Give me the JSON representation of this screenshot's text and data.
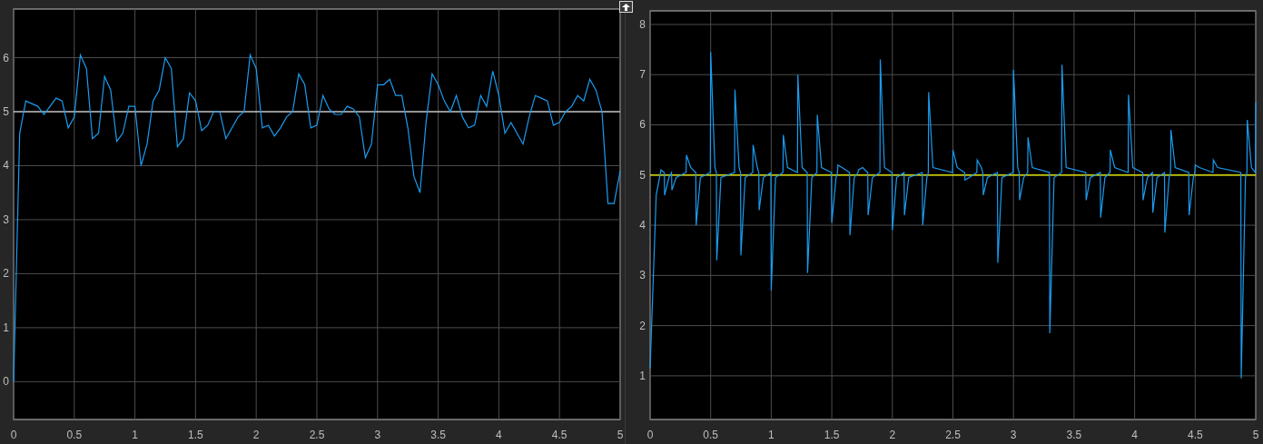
{
  "scopes": [
    {
      "chart_data": {
        "type": "line",
        "grid": true,
        "xlim": [
          0,
          5
        ],
        "ylim": [
          -0.7,
          6.9
        ],
        "xticks": [
          0,
          0.5,
          1,
          1.5,
          2,
          2.5,
          3,
          3.5,
          4,
          4.5,
          5
        ],
        "yticks": [
          0,
          1,
          2,
          3,
          4,
          5,
          6
        ],
        "x": [
          0,
          0.05,
          0.1,
          0.15,
          0.2,
          0.25,
          0.3,
          0.35,
          0.4,
          0.45,
          0.5,
          0.55,
          0.6,
          0.65,
          0.7,
          0.75,
          0.8,
          0.85,
          0.9,
          0.95,
          1,
          1.05,
          1.1,
          1.15,
          1.2,
          1.25,
          1.3,
          1.35,
          1.4,
          1.45,
          1.5,
          1.55,
          1.6,
          1.65,
          1.7,
          1.75,
          1.8,
          1.85,
          1.9,
          1.95,
          2,
          2.05,
          2.1,
          2.15,
          2.2,
          2.25,
          2.3,
          2.35,
          2.4,
          2.45,
          2.5,
          2.55,
          2.6,
          2.65,
          2.7,
          2.75,
          2.8,
          2.85,
          2.9,
          2.95,
          3,
          3.05,
          3.1,
          3.15,
          3.2,
          3.25,
          3.3,
          3.35,
          3.4,
          3.45,
          3.5,
          3.55,
          3.6,
          3.65,
          3.7,
          3.75,
          3.8,
          3.85,
          3.9,
          3.95,
          4,
          4.05,
          4.1,
          4.15,
          4.2,
          4.25,
          4.3,
          4.35,
          4.4,
          4.45,
          4.5,
          4.55,
          4.6,
          4.65,
          4.7,
          4.75,
          4.8,
          4.85,
          4.9,
          4.95,
          5
        ],
        "series": [
          {
            "color": "#1a9cf0",
            "values": [
              0,
              4.6,
              5.2,
              5.15,
              5.1,
              4.95,
              5.1,
              5.25,
              5.2,
              4.7,
              4.9,
              6.05,
              5.8,
              4.5,
              4.6,
              5.65,
              5.4,
              4.45,
              4.6,
              5.1,
              5.1,
              4.0,
              4.4,
              5.2,
              5.4,
              6.0,
              5.8,
              4.35,
              4.5,
              5.35,
              5.2,
              4.65,
              4.75,
              5.0,
              5.0,
              4.5,
              4.7,
              4.9,
              5.0,
              6.05,
              5.8,
              4.7,
              4.75,
              4.55,
              4.7,
              4.9,
              5.0,
              5.7,
              5.5,
              4.7,
              4.75,
              5.3,
              5.05,
              4.95,
              4.95,
              5.1,
              5.05,
              4.9,
              4.15,
              4.4,
              5.5,
              5.5,
              5.6,
              5.3,
              5.3,
              4.7,
              3.8,
              3.5,
              4.8,
              5.7,
              5.5,
              5.2,
              5.0,
              5.3,
              4.9,
              4.7,
              4.75,
              5.3,
              5.1,
              5.75,
              5.3,
              4.6,
              4.8,
              4.6,
              4.4,
              4.9,
              5.3,
              5.25,
              5.2,
              4.75,
              4.8,
              5.0,
              5.1,
              5.3,
              5.2,
              5.6,
              5.4,
              5.0,
              3.3,
              3.3,
              3.9
            ]
          },
          {
            "color": "#ffffff",
            "values": [
              5,
              5,
              5,
              5,
              5,
              5,
              5,
              5,
              5,
              5,
              5,
              5,
              5,
              5,
              5,
              5,
              5,
              5,
              5,
              5,
              5,
              5,
              5,
              5,
              5,
              5,
              5,
              5,
              5,
              5,
              5,
              5,
              5,
              5,
              5,
              5,
              5,
              5,
              5,
              5,
              5,
              5,
              5,
              5,
              5,
              5,
              5,
              5,
              5,
              5,
              5,
              5,
              5,
              5,
              5,
              5,
              5,
              5,
              5,
              5,
              5,
              5,
              5,
              5,
              5,
              5,
              5,
              5,
              5,
              5,
              5,
              5,
              5,
              5,
              5,
              5,
              5,
              5,
              5,
              5,
              5,
              5,
              5,
              5,
              5,
              5,
              5,
              5,
              5,
              5,
              5,
              5,
              5,
              5,
              5,
              5,
              5,
              5,
              5,
              5,
              5
            ]
          }
        ]
      }
    },
    {
      "chart_data": {
        "type": "line",
        "grid": true,
        "xlim": [
          0,
          5
        ],
        "ylim": [
          0.13,
          8.27
        ],
        "xticks": [
          0,
          0.5,
          1,
          1.5,
          2,
          2.5,
          3,
          3.5,
          4,
          4.5,
          5
        ],
        "yticks": [
          1,
          2,
          3,
          4,
          5,
          6,
          7,
          8
        ],
        "x": [
          0,
          0.05,
          0.09,
          0.117,
          0.12,
          0.155,
          0.177,
          0.18,
          0.215,
          0.297,
          0.3,
          0.335,
          0.377,
          0.38,
          0.415,
          0.497,
          0.5,
          0.535,
          0.547,
          0.55,
          0.585,
          0.697,
          0.7,
          0.735,
          0.747,
          0.75,
          0.785,
          0.847,
          0.85,
          0.885,
          0.897,
          0.9,
          0.935,
          0.997,
          1,
          1.035,
          1.097,
          1.1,
          1.135,
          1.217,
          1.22,
          1.255,
          1.297,
          1.3,
          1.335,
          1.377,
          1.38,
          1.415,
          1.497,
          1.5,
          1.535,
          1.547,
          1.55,
          1.585,
          1.647,
          1.65,
          1.685,
          1.717,
          1.72,
          1.755,
          1.797,
          1.8,
          1.835,
          1.897,
          1.9,
          1.935,
          1.997,
          2,
          2.035,
          2.097,
          2.1,
          2.135,
          2.247,
          2.25,
          2.285,
          2.297,
          2.3,
          2.335,
          2.497,
          2.5,
          2.535,
          2.597,
          2.6,
          2.635,
          2.697,
          2.7,
          2.735,
          2.747,
          2.75,
          2.785,
          2.867,
          2.87,
          2.905,
          2.997,
          3,
          3.035,
          3.047,
          3.05,
          3.085,
          3.117,
          3.12,
          3.155,
          3.297,
          3.3,
          3.335,
          3.397,
          3.4,
          3.435,
          3.597,
          3.6,
          3.635,
          3.717,
          3.72,
          3.755,
          3.797,
          3.8,
          3.835,
          3.947,
          3.95,
          3.985,
          4.067,
          4.07,
          4.105,
          4.147,
          4.15,
          4.185,
          4.247,
          4.25,
          4.285,
          4.297,
          4.3,
          4.335,
          4.447,
          4.45,
          4.485,
          4.497,
          4.5,
          4.535,
          4.647,
          4.65,
          4.685,
          4.877,
          4.88,
          4.915,
          4.927,
          4.93,
          4.965,
          4.997,
          5
        ],
        "series": [
          {
            "color": "#1a9cf0",
            "values": [
              1.15,
              4.6,
              5.1,
              5.05,
              4.6,
              4.95,
              5.05,
              4.7,
              4.95,
              5.05,
              5.4,
              5.15,
              5.05,
              4.0,
              4.95,
              5.05,
              7.45,
              5.15,
              5.05,
              3.3,
              4.95,
              5.05,
              6.7,
              5.15,
              5.05,
              3.4,
              4.95,
              5.05,
              5.6,
              5.15,
              5.05,
              4.3,
              4.95,
              5.05,
              2.7,
              4.95,
              5.05,
              5.8,
              5.15,
              5.05,
              7.0,
              5.15,
              5.05,
              3.05,
              4.95,
              5.05,
              6.2,
              5.15,
              5.05,
              4.05,
              4.95,
              5.05,
              5.2,
              5.15,
              5.05,
              3.8,
              4.95,
              5.05,
              5.1,
              5.15,
              5.05,
              4.2,
              4.95,
              5.05,
              7.3,
              5.15,
              5.05,
              3.9,
              4.95,
              5.05,
              4.2,
              4.95,
              5.05,
              4.0,
              4.95,
              5.05,
              6.65,
              5.15,
              5.05,
              5.5,
              5.15,
              5.05,
              4.9,
              4.95,
              5.05,
              5.3,
              5.15,
              5.05,
              4.6,
              4.95,
              5.05,
              3.25,
              4.95,
              5.05,
              7.1,
              5.15,
              5.05,
              4.5,
              4.95,
              5.05,
              5.75,
              5.15,
              5.05,
              1.85,
              4.95,
              5.05,
              7.2,
              5.15,
              5.05,
              4.5,
              4.95,
              5.05,
              4.15,
              4.95,
              5.05,
              5.5,
              5.15,
              5.05,
              6.6,
              5.15,
              5.05,
              4.5,
              4.95,
              5.05,
              4.25,
              4.95,
              5.05,
              3.85,
              4.95,
              5.05,
              5.9,
              5.15,
              5.05,
              4.2,
              4.95,
              5.05,
              5.2,
              5.15,
              5.05,
              5.3,
              5.15,
              5.05,
              0.95,
              4.95,
              5.05,
              6.1,
              5.15,
              5.05,
              6.45
            ]
          },
          {
            "color": "#ffff00",
            "values": [
              5,
              5,
              5,
              5,
              5,
              5,
              5,
              5,
              5,
              5,
              5,
              5,
              5,
              5,
              5,
              5,
              5,
              5,
              5,
              5,
              5,
              5,
              5,
              5,
              5,
              5,
              5,
              5,
              5,
              5,
              5,
              5,
              5,
              5,
              5,
              5,
              5,
              5,
              5,
              5,
              5,
              5,
              5,
              5,
              5,
              5,
              5,
              5,
              5,
              5,
              5,
              5,
              5,
              5,
              5,
              5,
              5,
              5,
              5,
              5,
              5,
              5,
              5,
              5,
              5,
              5,
              5,
              5,
              5,
              5,
              5,
              5,
              5,
              5,
              5,
              5,
              5,
              5,
              5,
              5,
              5,
              5,
              5,
              5,
              5,
              5,
              5,
              5,
              5,
              5,
              5,
              5,
              5,
              5,
              5,
              5,
              5,
              5,
              5,
              5,
              5,
              5,
              5,
              5,
              5,
              5,
              5,
              5,
              5,
              5,
              5,
              5,
              5,
              5,
              5,
              5,
              5,
              5,
              5,
              5,
              5,
              5,
              5,
              5,
              5,
              5,
              5,
              5,
              5,
              5,
              5,
              5,
              5,
              5,
              5,
              5,
              5,
              5,
              5,
              5,
              5,
              5,
              5,
              5,
              5,
              5,
              5,
              5,
              5
            ]
          }
        ]
      }
    }
  ]
}
